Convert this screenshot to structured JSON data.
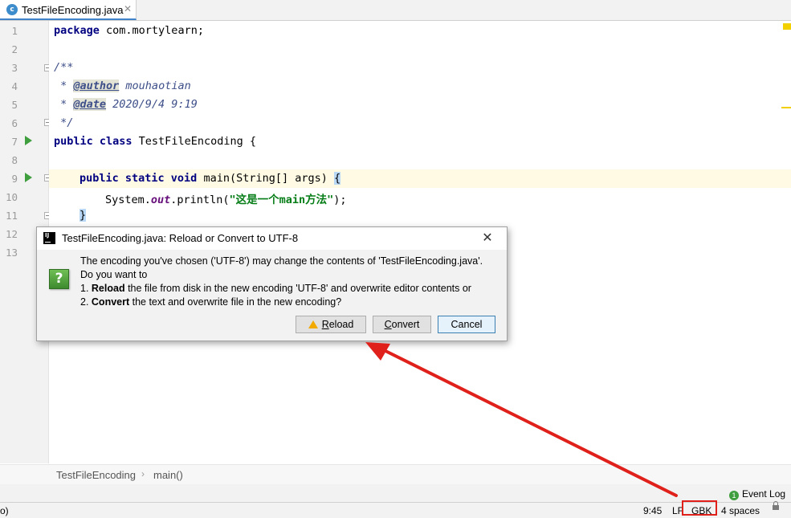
{
  "tab": {
    "icon": "class-c-icon",
    "icon_letter": "c",
    "label": "TestFileEncoding.java",
    "close": "✕"
  },
  "gutter": {
    "line_numbers": [
      "1",
      "2",
      "3",
      "4",
      "5",
      "6",
      "7",
      "8",
      "9",
      "10",
      "11",
      "12",
      "13"
    ]
  },
  "code": {
    "l1_kw": "package",
    "l1_rest": " com.mortylearn;",
    "l3": "/**",
    "l4_pre": " * ",
    "l4_tag": "@author",
    "l4_rest": " mouhaotian",
    "l5_pre": " * ",
    "l5_tag": "@date",
    "l5_rest": " 2020/9/4 9:19",
    "l6": " */",
    "l7_kw": "public class",
    "l7_rest": " TestFileEncoding {",
    "l9_kw": "public static void",
    "l9_rest": " main(String[] args) ",
    "l9_brace": "{",
    "l10_pre": "System.",
    "l10_static": "out",
    "l10_mid": ".println(",
    "l10_str": "\"这是一个main方法\"",
    "l10_end": ");",
    "l11_brace": "}"
  },
  "breadcrumb": {
    "class_name": "TestFileEncoding",
    "separator": "›",
    "method": "main()"
  },
  "event_log": {
    "badge": "1",
    "label": "Event Log"
  },
  "status": {
    "left_text": "o)",
    "position": "9:45",
    "line_sep": "LF",
    "encoding": "GBK",
    "indent": "4 spaces"
  },
  "dialog": {
    "title": "TestFileEncoding.java: Reload or Convert to UTF-8",
    "close": "✕",
    "question_icon": "?",
    "line1": "The encoding you've chosen ('UTF-8') may change the contents of 'TestFileEncoding.java'.",
    "line2": "Do you want to",
    "line3_num": "1. ",
    "line3_bold": "Reload",
    "line3_rest": " the file from disk in the new encoding 'UTF-8' and overwrite editor contents or",
    "line4_num": "2. ",
    "line4_bold": "Convert",
    "line4_rest": " the text and overwrite file in the new encoding?",
    "btn_reload_mn": "R",
    "btn_reload_rest": "eload",
    "btn_convert_mn": "C",
    "btn_convert_rest": "onvert",
    "btn_cancel": "Cancel"
  },
  "colors": {
    "accent": "#4083c9",
    "annotation_red": "#e0201a",
    "run_green": "#3f9f3f"
  }
}
